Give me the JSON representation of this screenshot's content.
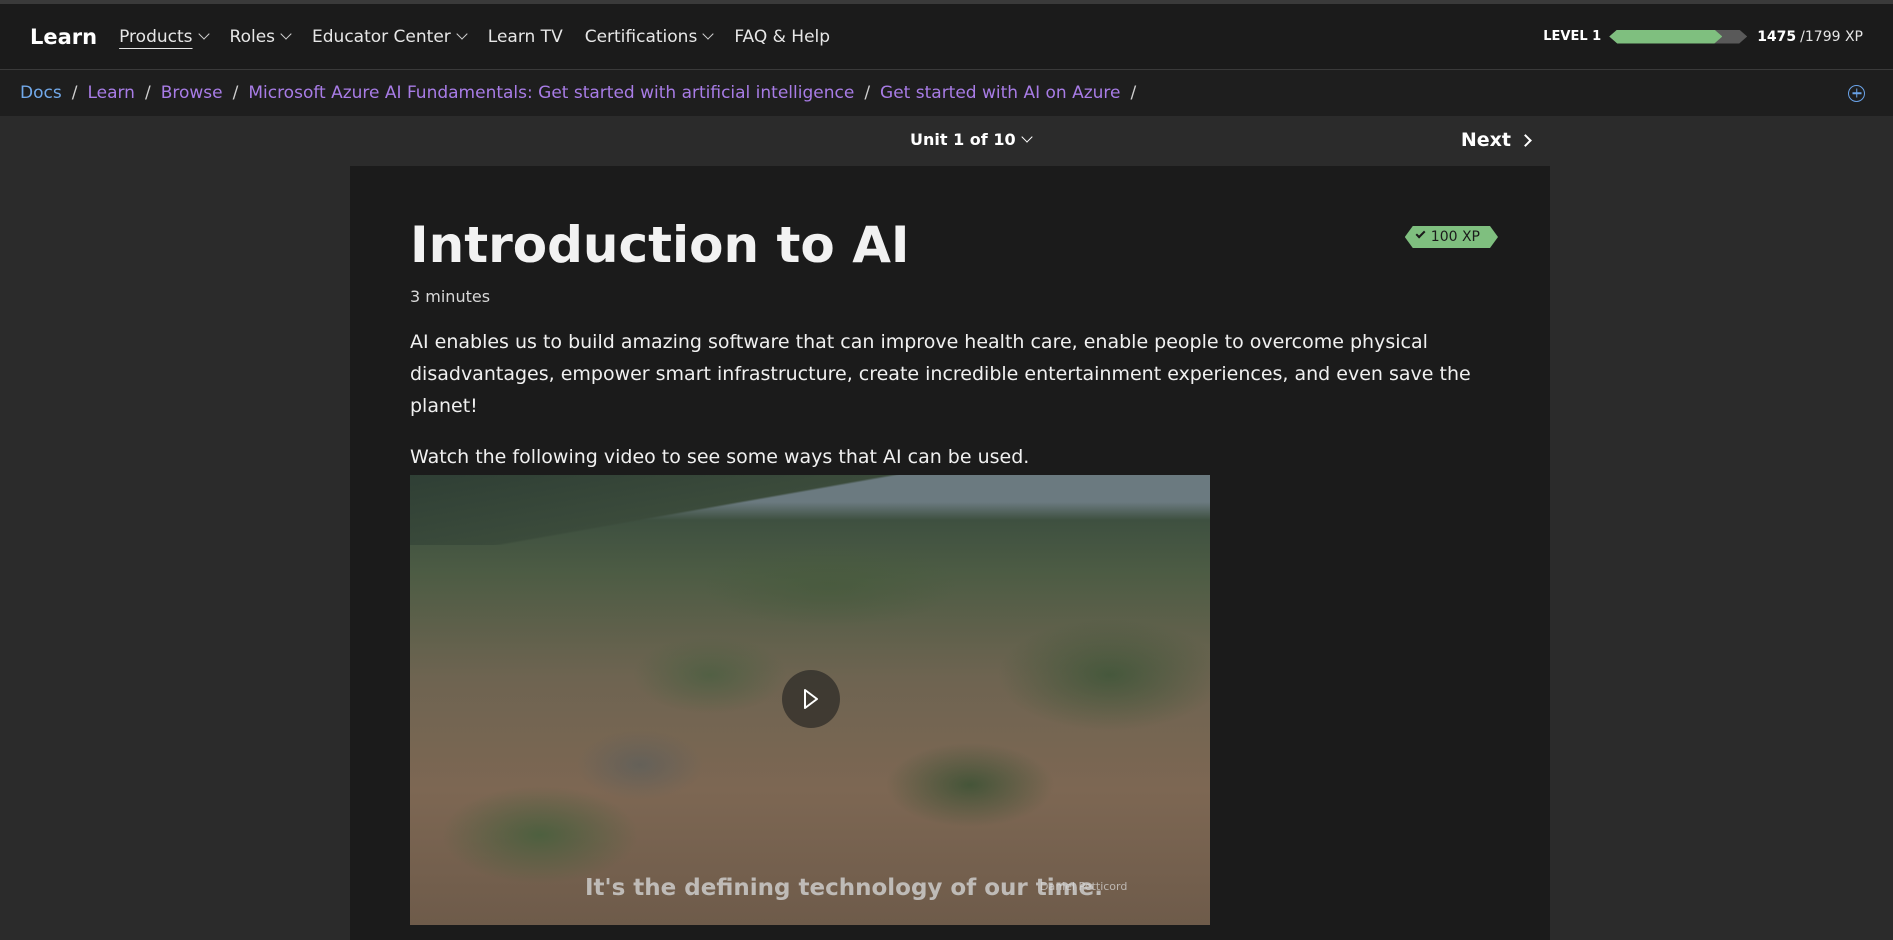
{
  "header": {
    "brand": "Learn",
    "nav": [
      {
        "label": "Products",
        "dropdown": true,
        "active": true
      },
      {
        "label": "Roles",
        "dropdown": true
      },
      {
        "label": "Educator Center",
        "dropdown": true
      },
      {
        "label": "Learn TV",
        "dropdown": false
      },
      {
        "label": "Certifications",
        "dropdown": true
      },
      {
        "label": "FAQ & Help",
        "dropdown": false
      }
    ],
    "level_label": "LEVEL 1",
    "xp_current": "1475",
    "xp_total": "/1799 XP",
    "xp_progress_fraction": 0.82,
    "progress_color": "#7fbf7f"
  },
  "breadcrumb": {
    "items": [
      "Docs",
      "Learn",
      "Browse",
      "Microsoft Azure AI Fundamentals: Get started with artificial intelligence",
      "Get started with AI on Azure"
    ],
    "separator": "/",
    "link_color": "#a87ce6",
    "first_link_color": "#72a9ea"
  },
  "unit_nav": {
    "unit_label": "Unit 1 of 10",
    "next_label": "Next"
  },
  "content": {
    "xp_badge": "100 XP",
    "title": "Introduction to AI",
    "duration": "3 minutes",
    "paragraph1": "AI enables us to build amazing software that can improve health care, enable people to overcome physical disadvantages, empower smart infrastructure, create incredible entertainment experiences, and even save the planet!",
    "paragraph2": "Watch the following video to see some ways that AI can be used.",
    "video": {
      "caption": "It's the defining technology of our time.",
      "credit": "Daniel Petticord"
    }
  }
}
